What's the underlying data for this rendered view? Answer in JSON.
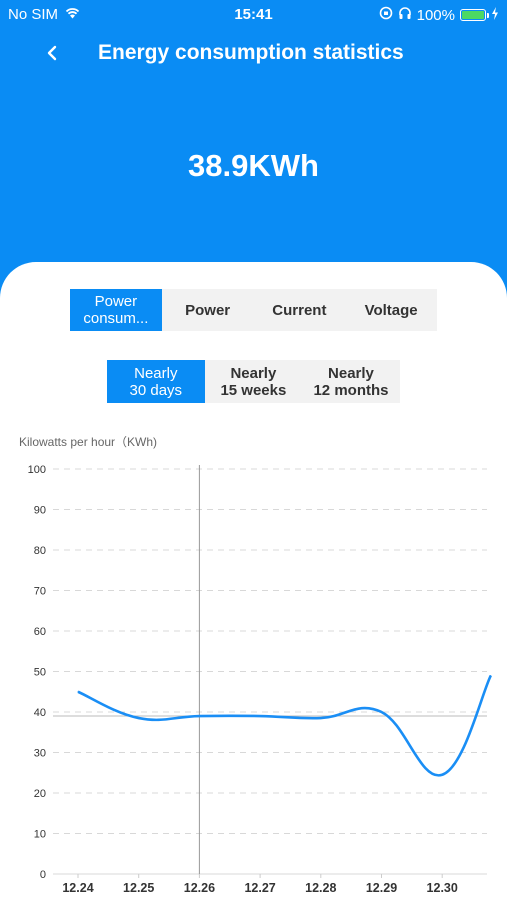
{
  "status_bar": {
    "carrier": "No SIM",
    "time": "15:41",
    "battery": "100%"
  },
  "nav": {
    "title": "Energy consumption statistics"
  },
  "summary": {
    "total": "38.9KWh"
  },
  "metric_tabs": [
    "Power consum...",
    "Power",
    "Current",
    "Voltage"
  ],
  "range_tabs": [
    "Nearly\n30 days",
    "Nearly\n15 weeks",
    "Nearly\n12 months"
  ],
  "colors": {
    "accent": "#0a8cf4",
    "line": "#1a8ef5"
  },
  "chart_data": {
    "type": "line",
    "ylabel": "Kilowatts per hour（KWh)",
    "ylim": [
      0,
      100
    ],
    "y_ticks": [
      "0",
      "10",
      "20",
      "30",
      "40",
      "50",
      "60",
      "70",
      "80",
      "90",
      "100"
    ],
    "x_ticks": [
      "12.24",
      "12.25",
      "12.26",
      "12.27",
      "12.28",
      "12.29",
      "12.30"
    ],
    "x": [
      0,
      1,
      2,
      3,
      4,
      5,
      6,
      6.8
    ],
    "values": [
      45,
      38.5,
      39,
      39,
      38.5,
      40,
      24.5,
      49
    ],
    "cursor_x": 2,
    "grid": true
  }
}
